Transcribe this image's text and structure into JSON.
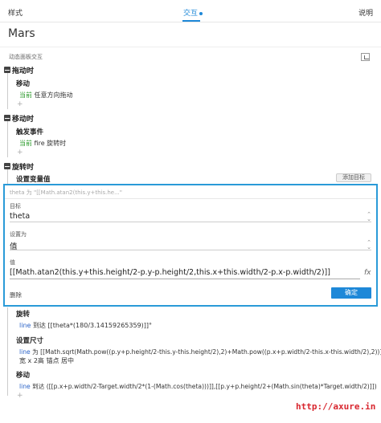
{
  "tabs": {
    "style": "样式",
    "interaction": "交互",
    "notes": "说明"
  },
  "title": "Mars",
  "section_label": "动态面板交互",
  "events": {
    "drag": {
      "label": "拖动时",
      "action": "移动",
      "current": "当前",
      "detail": "任意方向拖动"
    },
    "move": {
      "label": "移动时",
      "action": "触发事件",
      "current": "当前",
      "detail": "fire 旋转时"
    },
    "rotate": {
      "label": "旋转时"
    }
  },
  "set_var": {
    "label": "设置变量值",
    "add_target": "添加目标"
  },
  "panel": {
    "header": "theta 为 \"[[Math.atan2(this.y+this.he...\"",
    "target_label": "目标",
    "target_value": "theta",
    "setas_label": "设置为",
    "setas_value": "值",
    "value_label": "值",
    "value_expr": "[[Math.atan2(this.y+this.height/2-p.y-p.height/2,this.x+this.width/2-p.x-p.width/2)]]",
    "fx": "fx",
    "delete": "删除",
    "ok": "确定"
  },
  "rotate_action": {
    "label": "旋转",
    "target": "line",
    "text": "到达 [[theta*(180/3.14159265359)]]°"
  },
  "resize_action": {
    "label": "设置尺寸",
    "target": "line",
    "text": "为 [[Math.sqrt(Math.pow((p.y+p.height/2-this.y-this.height/2),2)+Math.pow((p.x+p.width/2-this.x-this.width/2),2))]]",
    "text2": "宽 x 2高 锚点 居中"
  },
  "move_action": {
    "label": "移动",
    "target": "line",
    "text": "到达 ([[p.x+p.width/2-Target.width/2*(1-(Math.cos(theta)))]],[[p.y+p.height/2+(Math.sin(theta)*Target.width/2)]])"
  },
  "plus": "+",
  "watermark": "http://axure.in"
}
